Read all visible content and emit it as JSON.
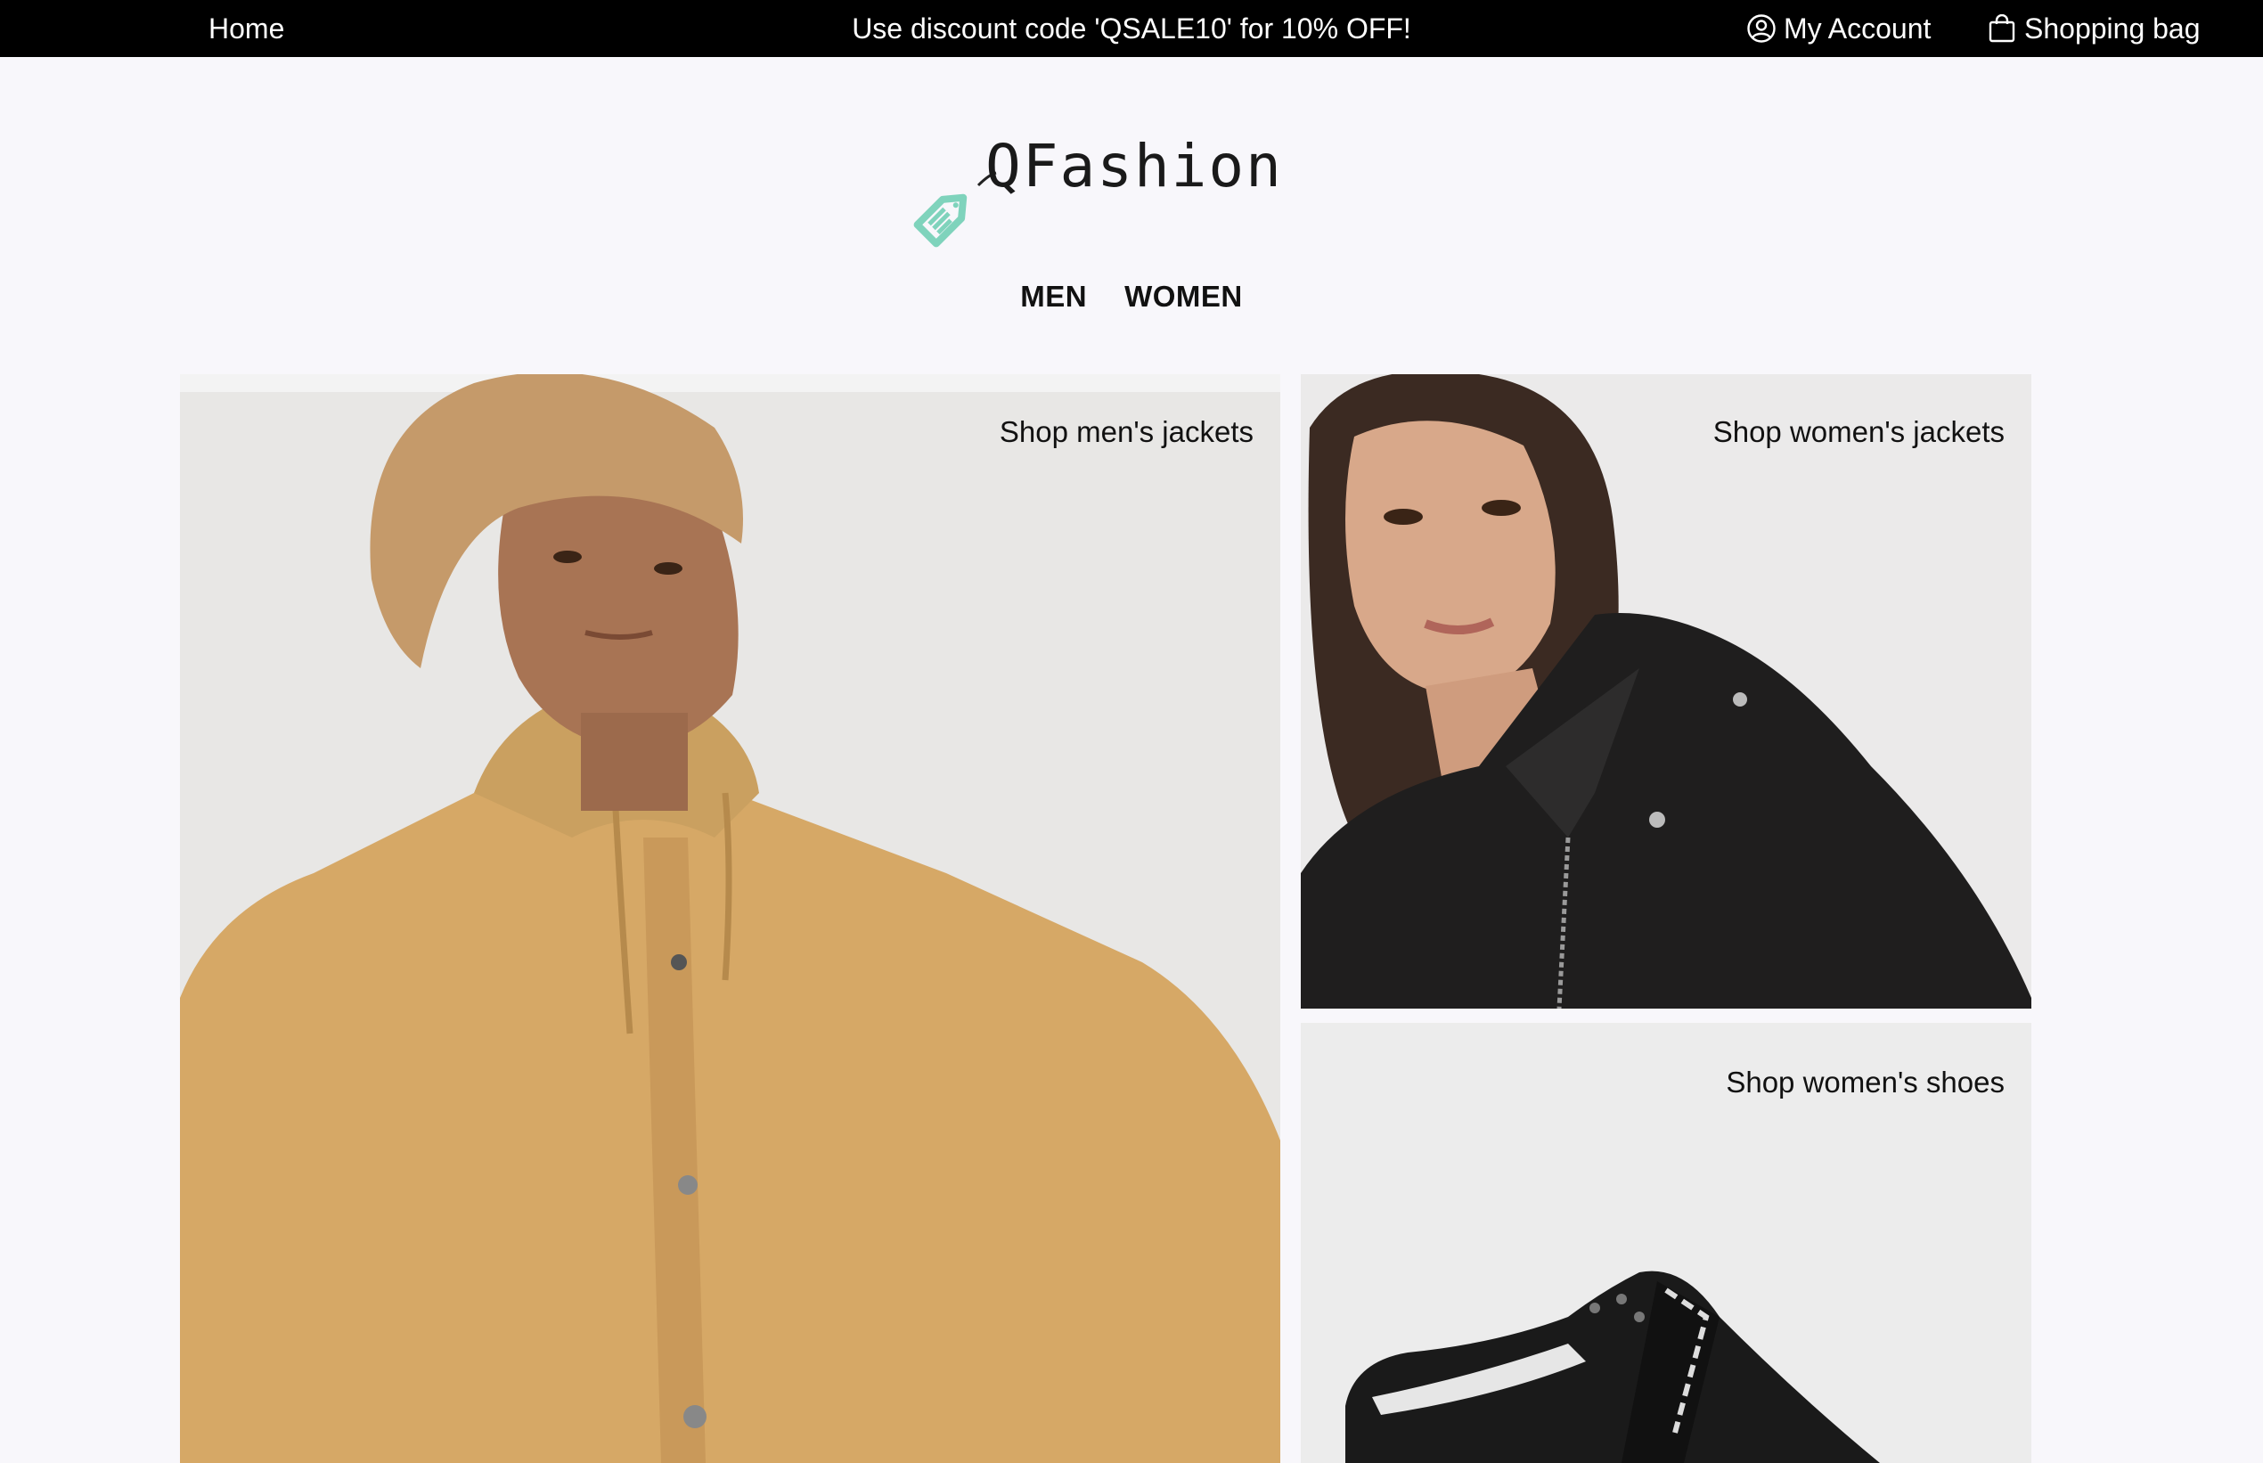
{
  "topbar": {
    "home_label": "Home",
    "promo_text": "Use discount code 'QSALE10' for 10% OFF!",
    "account_label": "My Account",
    "bag_label": "Shopping bag",
    "account_icon": "user-circle-icon",
    "bag_icon": "shopping-bag-icon"
  },
  "logo": {
    "text": "QFashion",
    "icon": "price-tag-icon",
    "accent_color": "#7fd3bc"
  },
  "categories": [
    {
      "label": "MEN"
    },
    {
      "label": "WOMEN"
    }
  ],
  "tiles": [
    {
      "label": "Shop men's jackets",
      "image": "man in tan hooded jacket and beanie"
    },
    {
      "label": "Shop women's jackets",
      "image": "woman in black leather jacket"
    },
    {
      "label": "Shop women's shoes",
      "image": "black sneaker with branded strap"
    }
  ],
  "colors": {
    "topbar_bg": "#000000",
    "page_bg": "#f8f7fb"
  }
}
